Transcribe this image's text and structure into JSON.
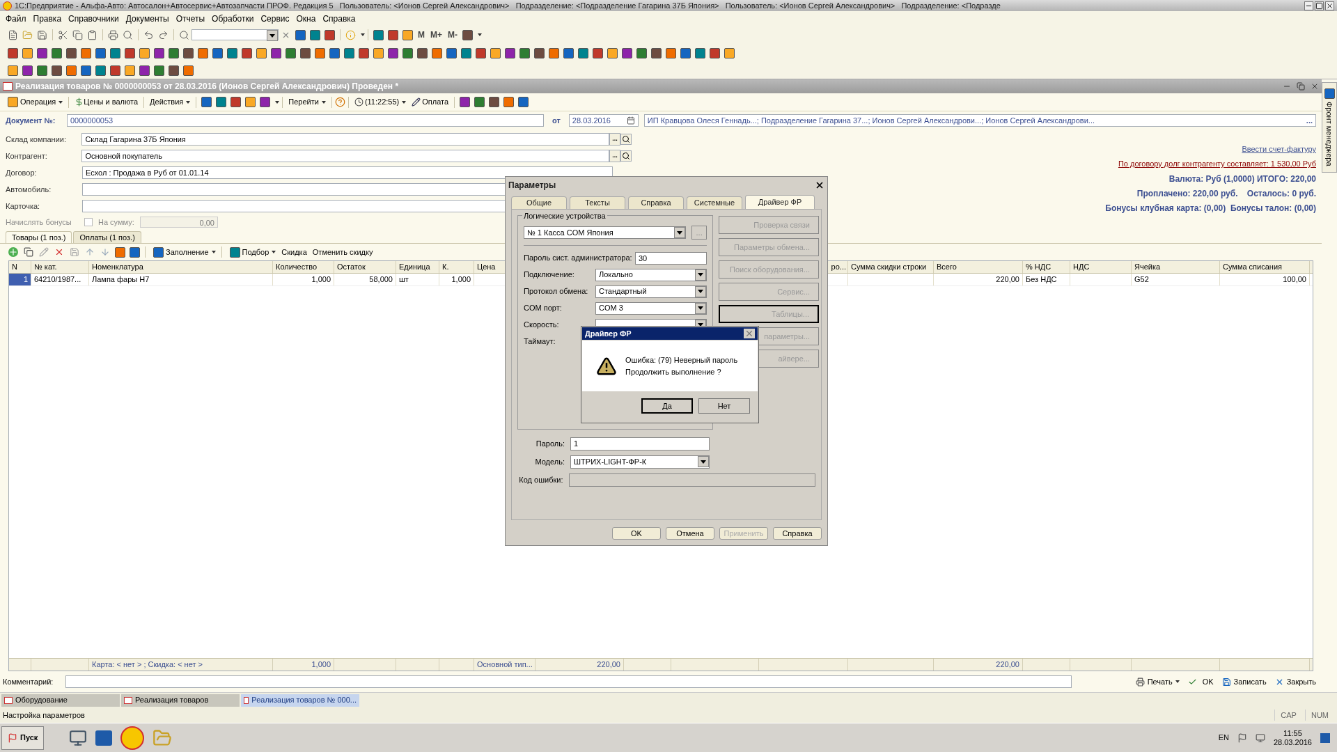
{
  "app_title": "1С:Предприятие - Альфа-Авто: Автосалон+Автосервис+Автозапчасти ПРОФ. Редакция 5   Пользователь: <Ионов Сергей Александрович>   Подразделение: <Подразделение Гагарина 37Б Япония>   Пользователь: <Ионов Сергей Александрович>   Подразделение: <Подразде",
  "menu": [
    "Файл",
    "Правка",
    "Справочники",
    "Документы",
    "Отчеты",
    "Обработки",
    "Сервис",
    "Окна",
    "Справка"
  ],
  "toolbar_texts": [
    "M",
    "M+",
    "M-"
  ],
  "doc": {
    "title": "Реализация товаров № 0000000053 от 28.03.2016 (Ионов Сергей Александрович) Проведен *",
    "toolbar": [
      {
        "label": "Операция",
        "dropdown": true
      },
      {
        "label": "Цены и валюта",
        "dropdown": false
      },
      {
        "label": "Действия",
        "dropdown": true
      },
      {
        "label": "Перейти",
        "dropdown": true
      },
      {
        "label": "(11:22:55)",
        "dropdown": true
      },
      {
        "label": "Оплата",
        "dropdown": false
      }
    ],
    "number_label": "Документ №:",
    "number": "0000000053",
    "date_label": "от",
    "date": "28.03.2016",
    "responsible_button": "...",
    "responsible": "ИП Кравцова Олеся Геннадь...; Подразделение Гагарина 37...; Ионов Сергей Александрови...; Ионов Сергей Александрови...",
    "fields": [
      {
        "label": "Склад компании:",
        "value": "Склад Гагарина 37Б Япония",
        "kind": "select",
        "button": "..."
      },
      {
        "label": "Контрагент:",
        "value": "Основной покупатель",
        "kind": "select",
        "button": "..."
      },
      {
        "label": "Договор:",
        "value": "Есхол : Продажа в Руб от 01.01.14",
        "kind": "plain"
      },
      {
        "label": "Автомобиль:",
        "kind": "plain"
      },
      {
        "label": "Карточка:",
        "kind": "plain"
      }
    ],
    "bonus": {
      "label": "Начислять бонусы",
      "checked": false,
      "sum_label": "На сумму:",
      "sum": "0,00",
      "disabled": true
    },
    "invoice_link": "Ввести счет-фактуру",
    "debt_link": "По договору долг контрагенту составляет: 1 530,00 Руб",
    "summary": [
      "Валюта: Руб (1,0000) ИТОГО: 220,00",
      "Проплачено: 220,00 руб.    Осталось: 0 руб.",
      "Бонусы клубная карта: (0,00)  Бонусы талон: (0,00)"
    ],
    "tabs": [
      {
        "label": "Товары (1 поз.)",
        "selected": true
      },
      {
        "label": "Оплаты (1 поз.)",
        "selected": false
      }
    ],
    "table_toolbar": [
      {
        "label": "Заполнение",
        "dropdown": true
      },
      {
        "label": "Подбор",
        "dropdown": true
      },
      {
        "label": "Скидка",
        "dropdown": false
      },
      {
        "label": "Отменить скидку",
        "dropdown": false
      }
    ],
    "table": {
      "columns": {
        "n": "N",
        "catalog_no": "№ кат.",
        "nomenclature": "Номенклатура",
        "quantity": "Количество",
        "balance": "Остаток",
        "unit": "Единица",
        "k": "К.",
        "price": "Цена",
        "column_12": "ро...",
        "discount": "Сумма скидки строки",
        "total": "Всего",
        "vat_rate": "% НДС",
        "vat": "НДС",
        "cell": "Ячейка",
        "write_off": "Сумма списания"
      },
      "rows": [
        {
          "selected": true,
          "cells": {
            "n": "1",
            "catalog_no": "64210/1987...",
            "nomenclature": "Лампа фары H7",
            "quantity": "1,000",
            "balance": "58,000",
            "unit": "шт",
            "k": "1,000",
            "total": "220,00",
            "vat_rate": "Без НДС",
            "cell": "G52",
            "write_off": "100,00"
          }
        }
      ],
      "footer": {
        "nomenclature": "Карта: < нет > ; Скидка: < нет >",
        "quantity": "1,000",
        "price": "Основной тип...",
        "column_9": "220,00",
        "total": "220,00"
      }
    },
    "comment_label": "Комментарий:",
    "actions": [
      {
        "label": "Печать",
        "dropdown": true
      },
      {
        "label": "OK",
        "dropdown": false
      },
      {
        "label": "Записать",
        "dropdown": false
      },
      {
        "label": "Закрыть",
        "dropdown": false
      }
    ]
  },
  "side_tab": "Фронт менеджера",
  "dialog": {
    "title": "Параметры",
    "tabs": [
      {
        "label": "Общие",
        "selected": false
      },
      {
        "label": "Тексты",
        "selected": false
      },
      {
        "label": "Справка",
        "selected": false
      },
      {
        "label": "Системные",
        "selected": false
      },
      {
        "label": "Драйвер ФР",
        "selected": true
      }
    ],
    "group_title": "Логические устройства",
    "device": "№ 1 Касса COM Япония",
    "device_button": "...",
    "fields": [
      {
        "label": "Пароль сист. администратора:",
        "value": "30",
        "kind": "text"
      },
      {
        "label": "Подключение:",
        "value": "Локально",
        "kind": "combo"
      },
      {
        "label": "Протокол обмена:",
        "value": "Стандартный",
        "kind": "combo"
      },
      {
        "label": "COM порт:",
        "value": "COM 3",
        "kind": "combo"
      },
      {
        "label": "Скорость:",
        "kind": "combo"
      },
      {
        "label": "Таймаут:",
        "kind": "label"
      }
    ],
    "side_buttons": [
      {
        "label": "Проверка связи",
        "disabled": true,
        "focused": false
      },
      {
        "label": "Параметры обмена...",
        "disabled": true,
        "focused": false
      },
      {
        "label": "Поиск оборудования...",
        "disabled": true,
        "focused": false
      },
      {
        "label": "Сервис...",
        "disabled": true,
        "focused": false
      },
      {
        "label": "Таблицы...",
        "disabled": true,
        "focused": true
      },
      {
        "label": "параметры...",
        "disabled": true,
        "focused": false
      },
      {
        "label": "айвере...",
        "disabled": true,
        "focused": false
      }
    ],
    "bottom_fields": [
      {
        "label": "Пароль:",
        "value": "1",
        "kind": "text"
      },
      {
        "label": "Модель:",
        "value": "ШТРИХ-LIGHT-ФР-К",
        "kind": "combo"
      },
      {
        "label": "Код ошибки:",
        "kind": "readonly"
      }
    ],
    "buttons": [
      {
        "label": "OK",
        "disabled": false
      },
      {
        "label": "Отмена",
        "disabled": false
      },
      {
        "label": "Применить",
        "disabled": true
      },
      {
        "label": "Справка",
        "disabled": false
      }
    ]
  },
  "message": {
    "title": "Драйвер ФР",
    "lines": [
      "Ошибка: (79) Неверный пароль",
      "Продолжить выполнение ?"
    ],
    "buttons": [
      {
        "label": "Да",
        "default": true
      },
      {
        "label": "Нет",
        "default": false
      }
    ]
  },
  "window_tabs": [
    {
      "label": "Оборудование",
      "selected": false
    },
    {
      "label": "Реализация товаров",
      "selected": false
    },
    {
      "label": "Реализация товаров № 000...",
      "selected": true
    }
  ],
  "status": {
    "text": "Настройка параметров",
    "indicators": [
      "CAP",
      "NUM"
    ]
  },
  "taskbar": {
    "start": "Пуск",
    "lang": "EN",
    "time": "11:55",
    "date": "28.03.2016"
  }
}
